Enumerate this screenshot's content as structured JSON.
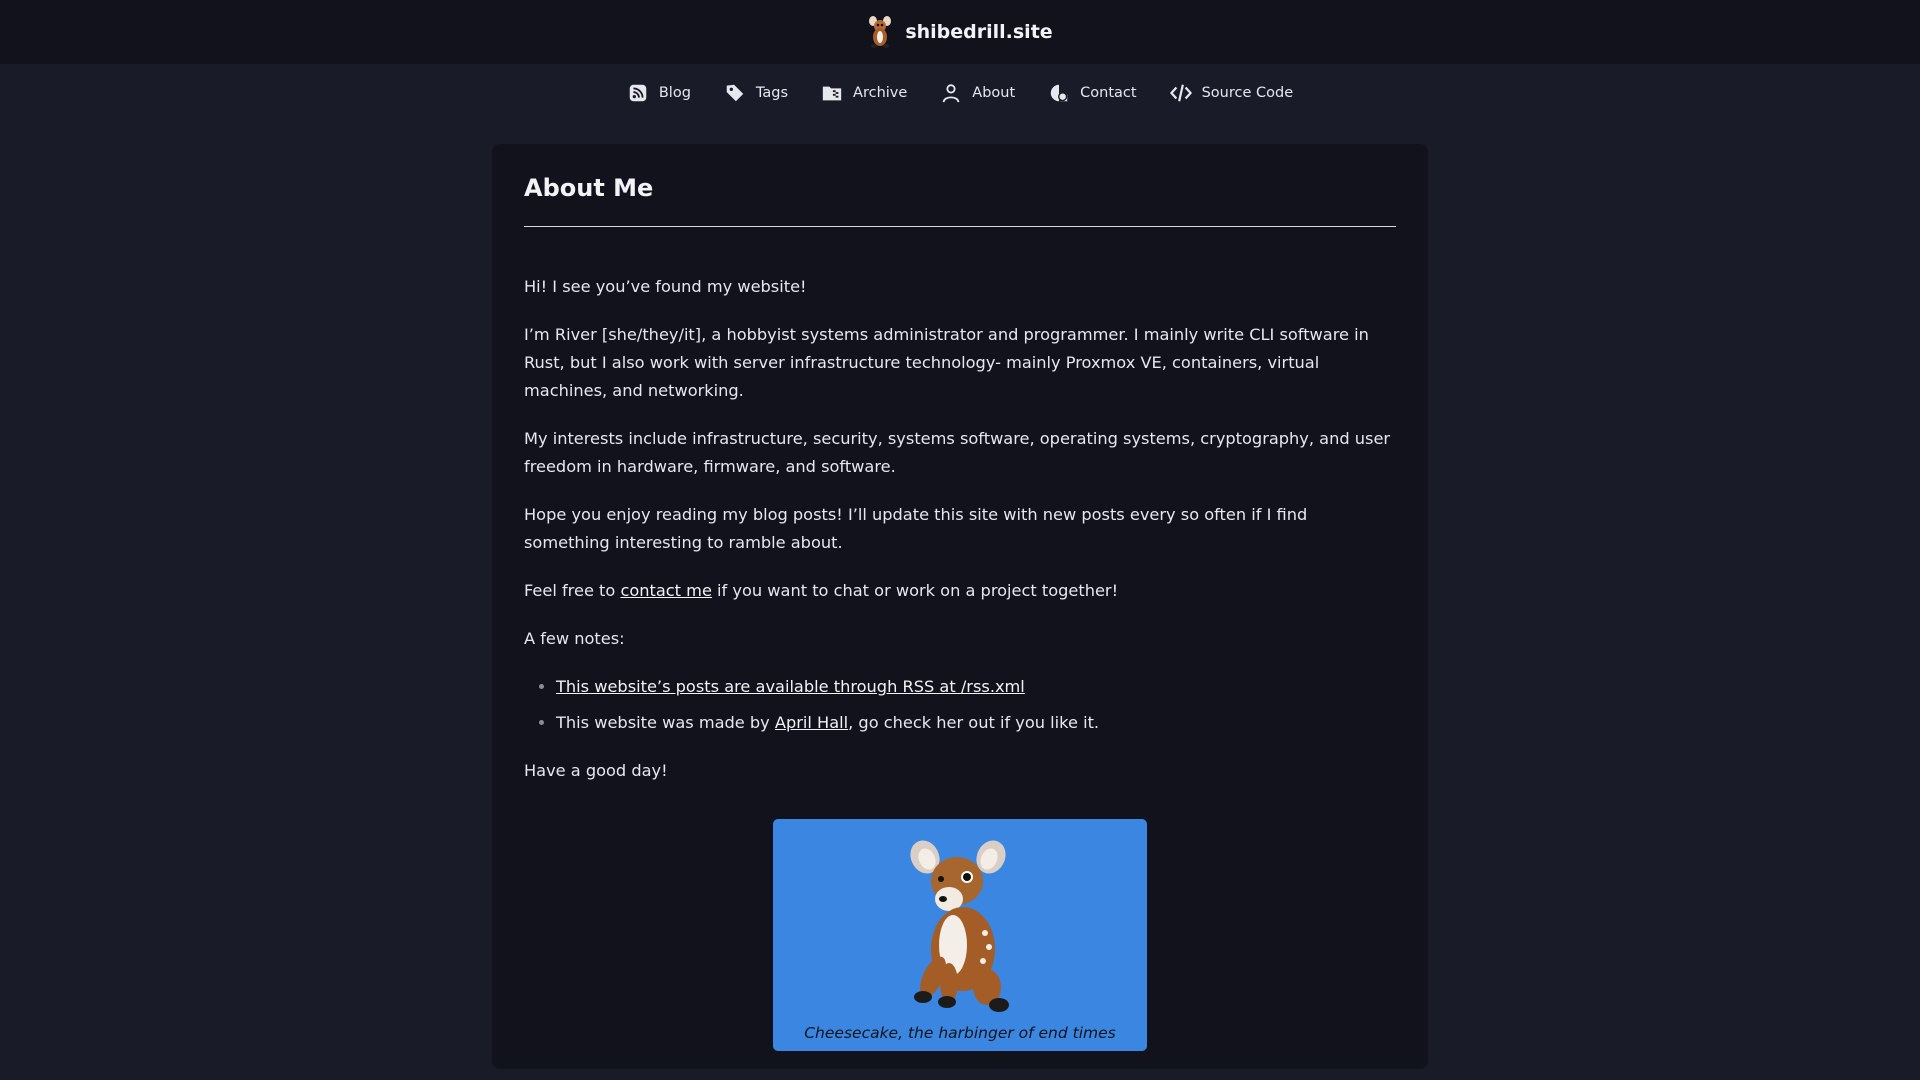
{
  "header": {
    "site_title": "shibedrill.site",
    "logo_icon": "deer-plush-logo-icon"
  },
  "nav": {
    "items": [
      {
        "label": "Blog",
        "icon": "rss-icon"
      },
      {
        "label": "Tags",
        "icon": "tag-icon"
      },
      {
        "label": "Archive",
        "icon": "archive-folder-icon"
      },
      {
        "label": "About",
        "icon": "person-icon"
      },
      {
        "label": "Contact",
        "icon": "contact-icon"
      },
      {
        "label": "Source Code",
        "icon": "code-icon"
      }
    ]
  },
  "page": {
    "title": "About Me",
    "paragraphs": {
      "p1": "Hi! I see you’ve found my website!",
      "p2": "I’m River [she/they/it], a hobbyist systems administrator and programmer. I mainly write CLI software in Rust, but I also work with server infrastructure technology- mainly Proxmox VE, containers, virtual machines, and networking.",
      "p3": "My interests include infrastructure, security, systems software, operating systems, cryptography, and user freedom in hardware, firmware, and software.",
      "p4": "Hope you enjoy reading my blog posts! I’ll update this site with new posts every so often if I find something interesting to ramble about.",
      "p5_before": "Feel free to ",
      "p5_link": "contact me",
      "p5_after": " if you want to chat or work on a project together!",
      "p6": "A few notes:",
      "p7": "Have a good day!"
    },
    "notes": {
      "note1_link": "This website’s posts are available through RSS at /rss.xml",
      "note2_before": "This website was made by ",
      "note2_link": "April Hall",
      "note2_after": ", go check her out if you like it."
    },
    "figure": {
      "caption": "Cheesecake, the harbinger of end times",
      "background": "#3a86e0"
    }
  },
  "colors": {
    "page_bg": "#1a1b28",
    "card_bg": "#11121b",
    "header_bg": "#11121b",
    "text": "#e6e7ef"
  }
}
